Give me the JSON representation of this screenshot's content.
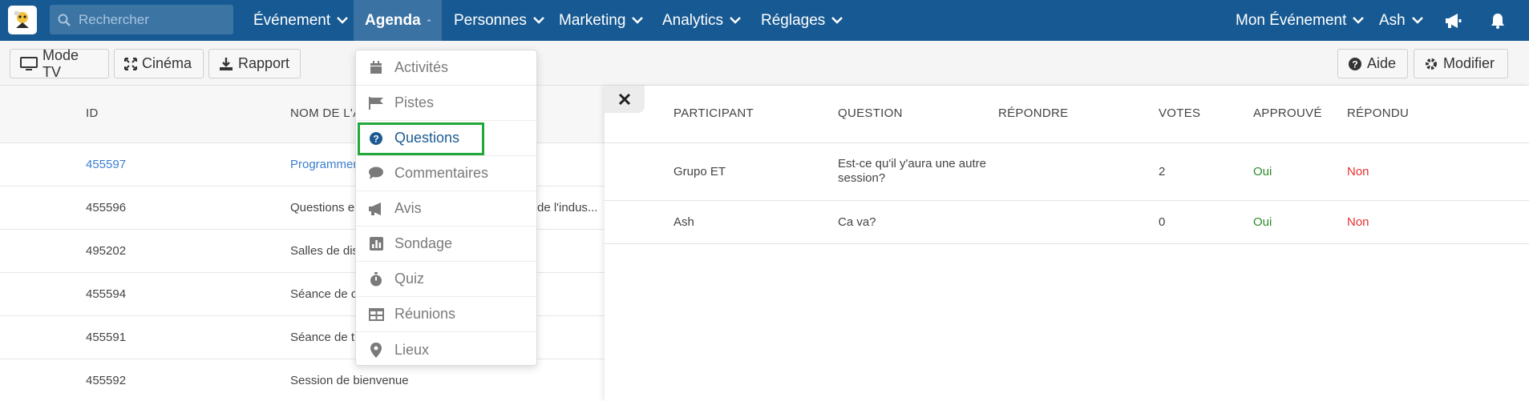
{
  "colors": {
    "nav_bg": "#175a93",
    "active_nav": "#3a72a4",
    "link": "#3b7fd0",
    "highlight": "#22a83a",
    "yes": "#2e8b2e",
    "no": "#e53030"
  },
  "search": {
    "placeholder": "Rechercher"
  },
  "nav": {
    "items": [
      {
        "label": "Événement",
        "icon": "chevron-down-icon"
      },
      {
        "label": "Agenda",
        "icon": "chevron-up-icon",
        "active": true
      },
      {
        "label": "Personnes",
        "icon": "chevron-down-icon"
      },
      {
        "label": "Marketing",
        "icon": "chevron-down-icon"
      },
      {
        "label": "Analytics",
        "icon": "chevron-down-icon"
      },
      {
        "label": "Réglages",
        "icon": "chevron-down-icon"
      }
    ],
    "right": {
      "event": "Mon Événement",
      "user": "Ash"
    }
  },
  "toolbar": {
    "tv": "Mode TV",
    "cinema": "Cinéma",
    "report": "Rapport",
    "help": "Aide",
    "edit": "Modifier"
  },
  "left_table": {
    "headers": {
      "id": "ID",
      "name": "NOM DE L'A"
    },
    "rows": [
      {
        "id": "455597",
        "name": "Programmer"
      },
      {
        "id": "455596",
        "name": "Questions e",
        "extra": "de l'indus..."
      },
      {
        "id": "495202",
        "name": "Salles de dis"
      },
      {
        "id": "455594",
        "name": "Séance de c"
      },
      {
        "id": "455591",
        "name": "Séance de tr"
      },
      {
        "id": "455592",
        "name": "Session de bienvenue"
      }
    ]
  },
  "agenda_menu": {
    "items": [
      {
        "label": "Activités",
        "icon": "calendar-icon"
      },
      {
        "label": "Pistes",
        "icon": "flag-icon"
      },
      {
        "label": "Questions",
        "icon": "question-circle-icon"
      },
      {
        "label": "Commentaires",
        "icon": "comment-icon"
      },
      {
        "label": "Avis",
        "icon": "megaphone-icon"
      },
      {
        "label": "Sondage",
        "icon": "bar-chart-icon"
      },
      {
        "label": "Quiz",
        "icon": "stopwatch-icon"
      },
      {
        "label": "Réunions",
        "icon": "table-icon"
      },
      {
        "label": "Lieux",
        "icon": "map-marker-icon"
      }
    ]
  },
  "questions_table": {
    "headers": {
      "participant": "PARTICIPANT",
      "question": "QUESTION",
      "answer": "RÉPONDRE",
      "votes": "VOTES",
      "approved": "APPROUVÉ",
      "answered": "RÉPONDU"
    },
    "rows": [
      {
        "participant": "Grupo ET",
        "question_l1": "Est-ce qu'il y'aura une autre",
        "question_l2": "session?",
        "votes": "2",
        "approved": "Oui",
        "answered": "Non"
      },
      {
        "participant": "Ash",
        "question_l1": "Ca va?",
        "votes": "0",
        "approved": "Oui",
        "answered": "Non"
      }
    ]
  }
}
